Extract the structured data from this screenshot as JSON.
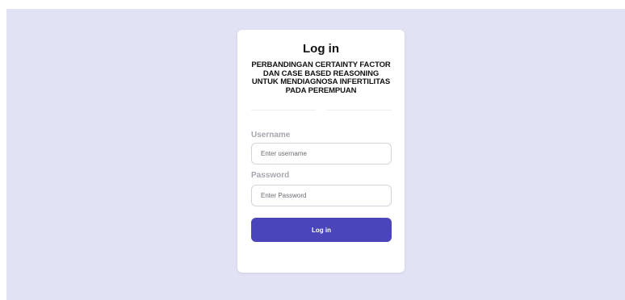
{
  "login_form": {
    "title": "Log in",
    "subtitle_lines": [
      "PERBANDINGAN CERTAINTY FACTOR",
      "DAN CASE BASED REASONING",
      "UNTUK MENDIAGNOSA INFERTILITAS",
      "PADA PEREMPUAN"
    ],
    "username": {
      "label": "Username",
      "placeholder": "Enter username",
      "value": ""
    },
    "password": {
      "label": "Password",
      "placeholder": "Enter Password",
      "value": ""
    },
    "submit_label": "Log in"
  },
  "colors": {
    "background": "#e1e2f4",
    "card": "#ffffff",
    "button": "#4a45b8",
    "label": "#a6a6ae"
  }
}
